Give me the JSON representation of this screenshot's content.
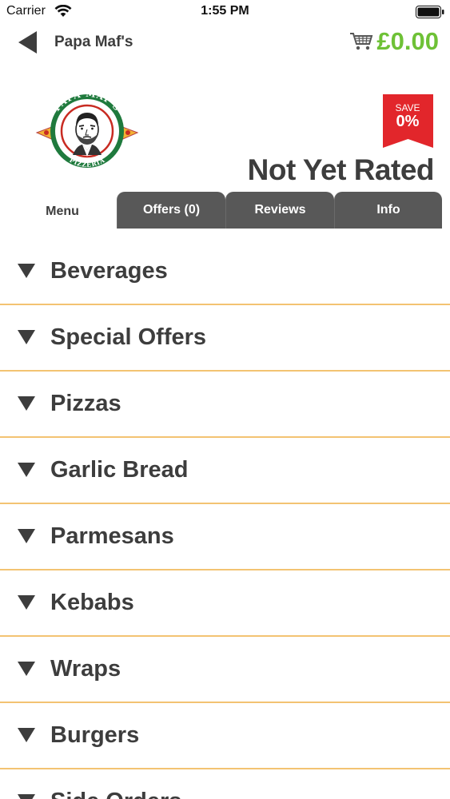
{
  "status_bar": {
    "carrier": "Carrier",
    "time": "1:55 PM"
  },
  "nav": {
    "title": "Papa Maf's",
    "back_icon": "back-arrow-icon",
    "cart_icon": "shopping-cart-icon",
    "cart_total": "£0.00"
  },
  "logo": {
    "top_text": "PAPA MAF'S",
    "bottom_text": "PIZZERIA"
  },
  "save_badge": {
    "label": "SAVE",
    "value": "0%"
  },
  "rating": "Not Yet Rated",
  "tabs": [
    {
      "label": "Menu",
      "active": true
    },
    {
      "label": "Offers (0)",
      "active": false
    },
    {
      "label": "Reviews",
      "active": false
    },
    {
      "label": "Info",
      "active": false
    }
  ],
  "categories": [
    {
      "label": "Beverages"
    },
    {
      "label": "Special Offers"
    },
    {
      "label": "Pizzas"
    },
    {
      "label": "Garlic Bread"
    },
    {
      "label": "Parmesans"
    },
    {
      "label": "Kebabs"
    },
    {
      "label": "Wraps"
    },
    {
      "label": "Burgers"
    },
    {
      "label": "Side Orders"
    }
  ],
  "colors": {
    "price_green": "#6ec136",
    "badge_red": "#e2262b",
    "tab_gray": "#585858",
    "divider_gold": "#f3c372",
    "text_dark": "#3d3d3d"
  }
}
